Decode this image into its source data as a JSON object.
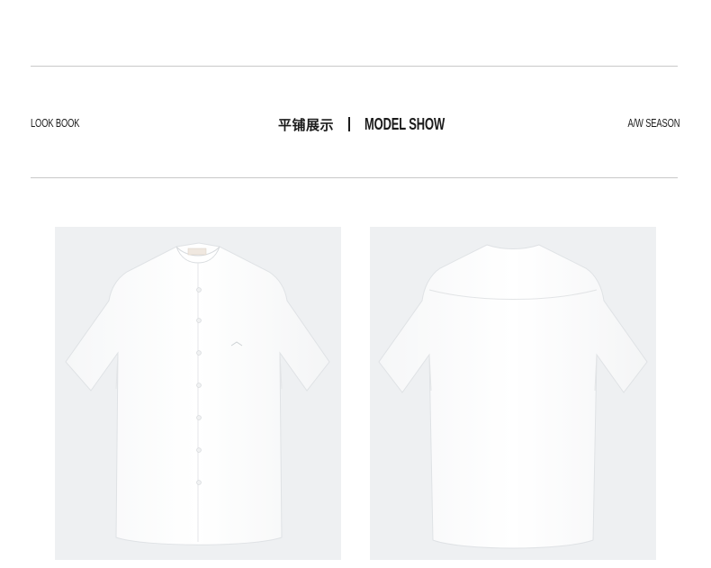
{
  "header": {
    "left_label": "LOOK BOOK",
    "center_cn": "平铺展示",
    "center_en": "MODEL SHOW",
    "right_label": "A/W SEASON"
  },
  "gallery": {
    "items": [
      {
        "name": "shirt-front",
        "view": "front"
      },
      {
        "name": "shirt-back",
        "view": "back"
      }
    ]
  }
}
